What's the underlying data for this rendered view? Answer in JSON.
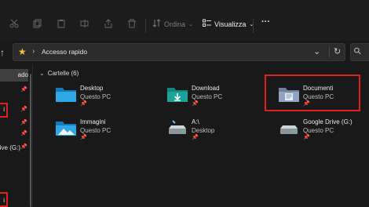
{
  "toolbar": {
    "sort_label": "Ordina",
    "view_label": "Visualizza",
    "more": "···"
  },
  "address": {
    "path": "Accesso rapido"
  },
  "sidebar": {
    "items": [
      {
        "label": "ado"
      },
      {
        "label": "i"
      },
      {
        "label": "i"
      },
      {
        "label": "i"
      },
      {
        "label": "rive (G:)"
      },
      {
        "label": "i"
      }
    ]
  },
  "main": {
    "group_title": "Cartelle (6)",
    "folders": [
      {
        "name": "Desktop",
        "location": "Questo PC"
      },
      {
        "name": "Download",
        "location": "Questo PC"
      },
      {
        "name": "Documenti",
        "location": "Questo PC"
      },
      {
        "name": "Immagini",
        "location": "Questo PC"
      },
      {
        "name": "A:\\",
        "location": "Desktop"
      },
      {
        "name": "Google Drive (G:)",
        "location": "Questo PC"
      }
    ]
  },
  "colors": {
    "accent_red": "#e0201c",
    "folder_blue": "#1e9bd7",
    "folder_teal": "#1ba39a",
    "star": "#f2c12e"
  }
}
